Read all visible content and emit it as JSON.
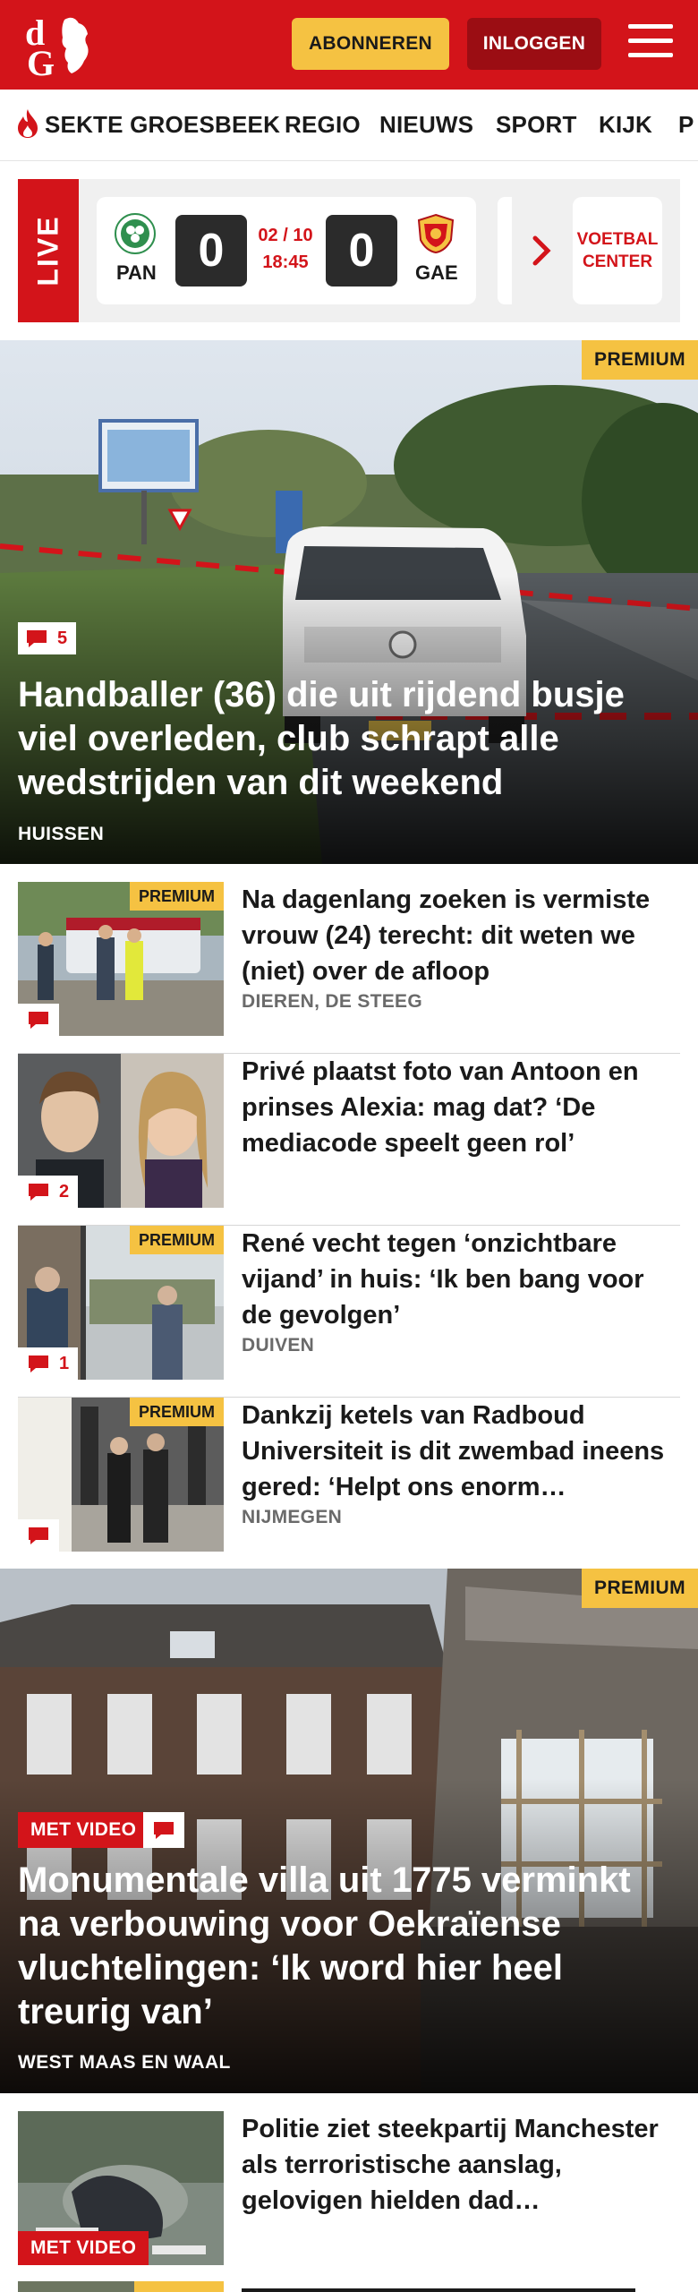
{
  "header": {
    "logo_text": "dG",
    "subscribe_label": "ABONNEREN",
    "login_label": "INLOGGEN",
    "brand_color": "#d3141a"
  },
  "nav": {
    "items": [
      {
        "label": "SEKTE GROESBEEK",
        "hot": true
      },
      {
        "label": "REGIO"
      },
      {
        "label": "NIEUWS"
      },
      {
        "label": "SPORT"
      },
      {
        "label": "KIJK"
      },
      {
        "label": "P"
      }
    ]
  },
  "live": {
    "badge": "LIVE",
    "home_code": "PAN",
    "away_code": "GAE",
    "home_score": "0",
    "away_score": "0",
    "date": "02 / 10",
    "time": "18:45",
    "voetbal_center": "VOETBAL CENTER"
  },
  "hero": {
    "premium": "PREMIUM",
    "comments": "5",
    "title": "Handballer (36) die uit rijdend busje viel overleden, club schrapt alle wedstrijden van dit weekend",
    "kicker": "HUISSEN"
  },
  "articles": [
    {
      "title": "Na dagenlang zoeken is vermiste vrouw (24) terecht: dit weten we (niet) over de afloop",
      "kicker": "DIEREN, DE STEEG",
      "premium": "PREMIUM",
      "comments": ""
    },
    {
      "title": "Privé plaatst foto van Antoon en prinses Alexia: mag dat? ‘De mediacode speelt geen rol’",
      "kicker": "",
      "premium": "",
      "comments": "2"
    },
    {
      "title": "René vecht tegen ‘onzichtbare vijand’ in huis: ‘Ik ben bang voor de gevolgen’",
      "kicker": "DUIVEN",
      "premium": "PREMIUM",
      "comments": "1"
    },
    {
      "title": "Dankzij ketels van Radboud Universiteit is dit zwembad ineens gered: ‘Helpt ons enorm…",
      "kicker": "NIJMEGEN",
      "premium": "PREMIUM",
      "comments": ""
    }
  ],
  "hero2": {
    "premium": "PREMIUM",
    "video": "MET VIDEO",
    "title": "Monumentale villa uit 1775 verminkt na verbouwing voor Oekraïense vluchtelingen: ‘Ik word hier heel treurig van’",
    "kicker": "WEST MAAS EN WAAL"
  },
  "article_bottom": {
    "title": "Politie ziet steekpartij Manchester als terroristische aanslag, gelovigen hielden dad…",
    "video": "MET VIDEO"
  },
  "partial_item": {
    "premium": "PREMIUM"
  },
  "colors": {
    "accent_red": "#d3141a",
    "premium_yellow": "#f5c242",
    "dark_red": "#9b0d13"
  }
}
